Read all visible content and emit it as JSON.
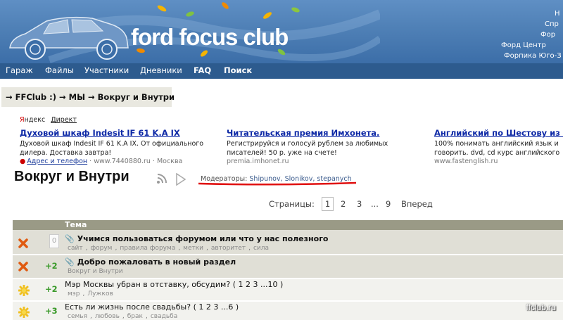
{
  "header": {
    "logo_text": "ford focus club",
    "links": [
      "Н",
      "Спр",
      "Фор",
      "Форд Центр",
      "Форпика Юго-З"
    ]
  },
  "nav": {
    "items": [
      "Гараж",
      "Файлы",
      "Участники",
      "Дневники",
      "FAQ",
      "Поиск"
    ]
  },
  "breadcrumb": "→ FFClub :) → МЫ → Вокруг и Внутри",
  "ads": {
    "brand_yandex": "Яндекс",
    "brand_direct": "Директ",
    "items": [
      {
        "title": "Духовой шкаф Indesit IF 61 K.A IX",
        "body": "Духовой шкаф Indesit IF 61 K.A IX. От официального дилера. Доставка завтра!",
        "url": "www.7440880.ru",
        "address": "Адрес и телефон",
        "city": "Москва"
      },
      {
        "title": "Читательская премия Имхонета.",
        "body": "Регистрируйся и голосуй рублем за любимых писателей! 50 р. уже на счете!",
        "url": "premia.imhonet.ru"
      },
      {
        "title": "Английский по Шестову из Гинн",
        "body": "100% понимать английский язык и говорить. dvd, cd курс английского",
        "url": "www.fastenglish.ru"
      }
    ]
  },
  "forum": {
    "title": "Вокруг и Внутри",
    "moderators_label": "Модераторы:",
    "moderators": "Shipunov, Slonikov, stepanych"
  },
  "pagination": {
    "label": "Страницы:",
    "current": "1",
    "pages": [
      "2",
      "3"
    ],
    "ellipsis": "...",
    "last": "9",
    "next": "Вперед"
  },
  "table": {
    "header": "Тема",
    "rows": [
      {
        "count": "0",
        "title": "Учимся пользоваться форумом или что у нас полезного",
        "tags": [
          "сайт",
          "форум",
          "правила форума",
          "метки",
          "авторитет",
          "сила"
        ],
        "sticky": true,
        "status": "closed"
      },
      {
        "count": "+2",
        "title": "Добро пожаловать в новый раздел",
        "tags": [
          "Вокруг и Внутри"
        ],
        "sticky": true,
        "status": "closed"
      },
      {
        "count": "+2",
        "title": "Мэр Москвы убран в отставку, обсудим? ( 1 2 3 ...10 )",
        "tags": [
          "мэр",
          "Лужков"
        ],
        "sticky": false,
        "status": "new"
      },
      {
        "count": "+3",
        "title": "Есть ли жизнь после свадьбы? ( 1 2 3 ...6 )",
        "tags": [
          "семья",
          "любовь",
          "брак",
          "свадьба"
        ],
        "sticky": false,
        "status": "new"
      }
    ]
  },
  "watermark": "ffclub.ru",
  "colors": {
    "header_blue": "#4f80b6",
    "nav_blue": "#2d5b8e",
    "ad_link": "#0e29a6",
    "table_header": "#9a9a86",
    "closed_icon": "#e05a10",
    "new_icon": "#f0c020",
    "count_green": "#3a9a2a"
  }
}
